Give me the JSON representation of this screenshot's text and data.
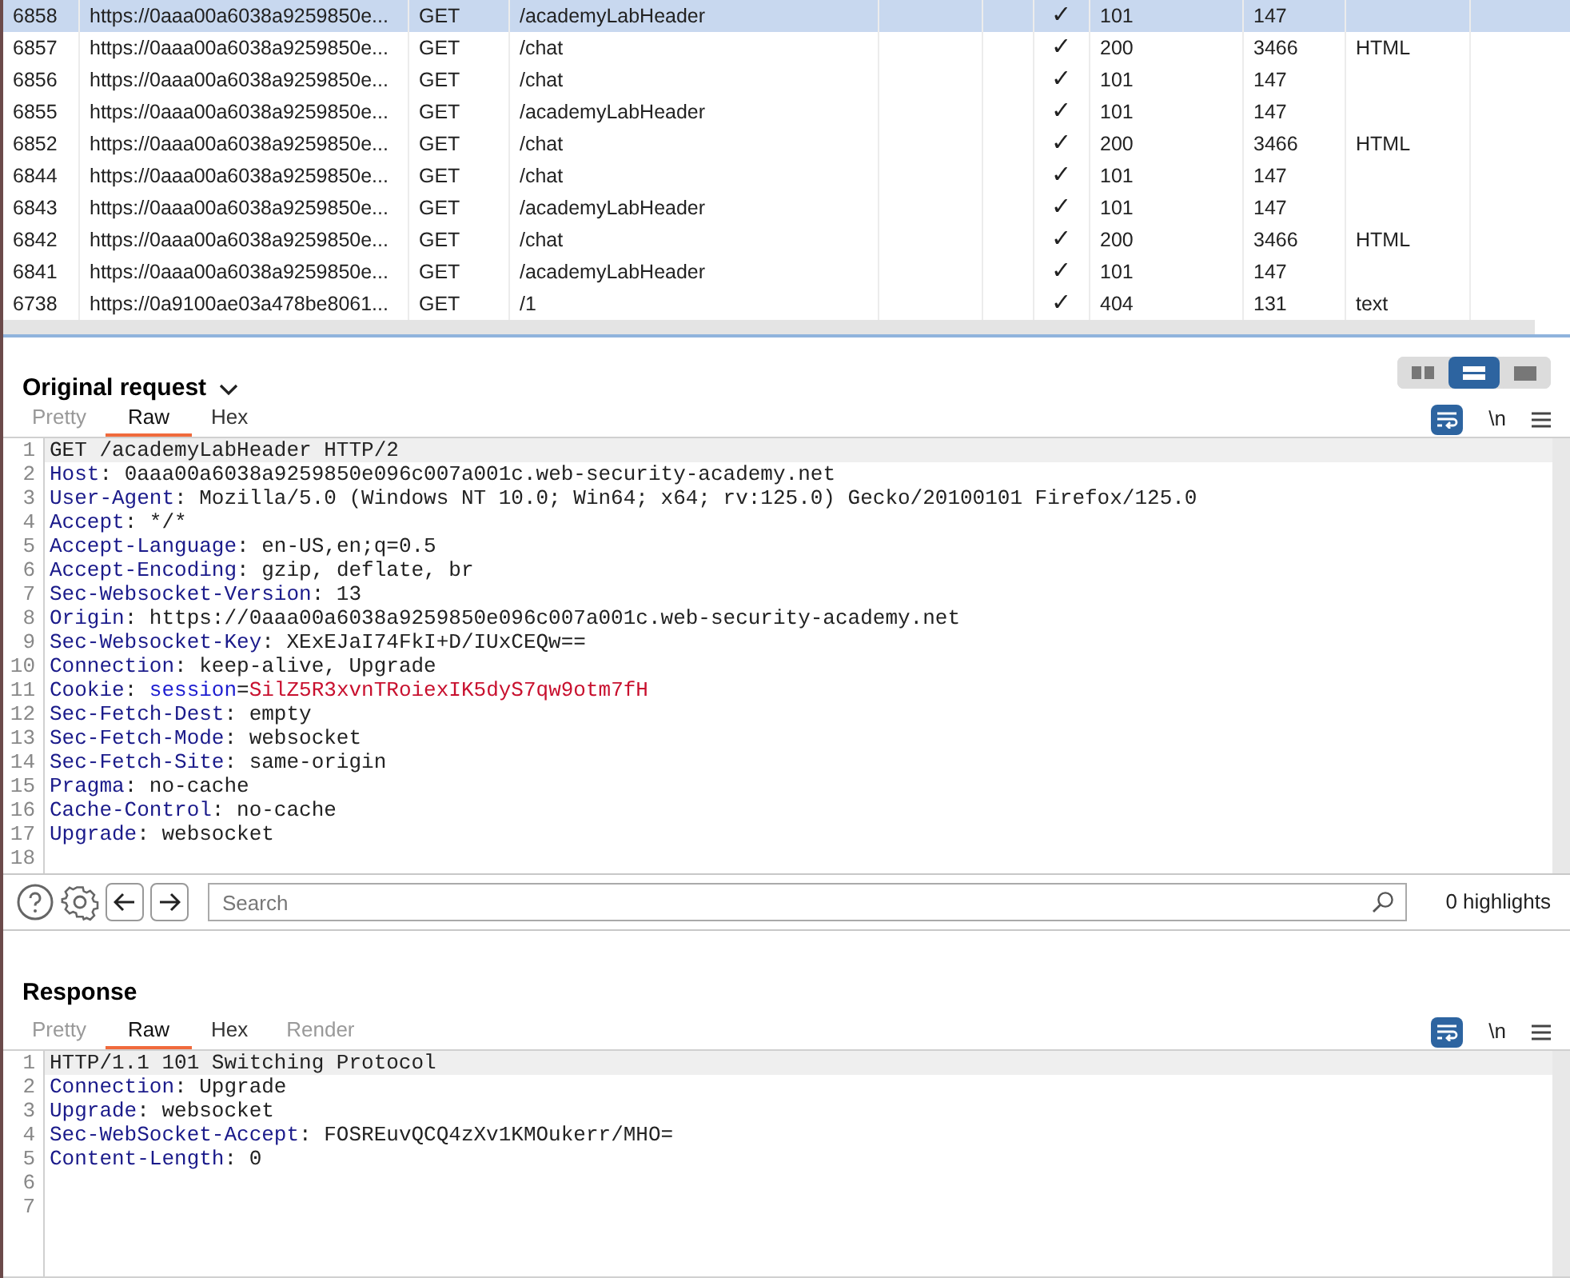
{
  "table": {
    "rows": [
      {
        "cells": [
          "6858",
          "https://0aaa00a6038a9259850e...",
          "GET",
          "/academyLabHeader",
          "✓",
          "101",
          "147",
          ""
        ],
        "selected": true
      },
      {
        "cells": [
          "6857",
          "https://0aaa00a6038a9259850e...",
          "GET",
          "/chat",
          "✓",
          "200",
          "3466",
          "HTML"
        ],
        "selected": false
      },
      {
        "cells": [
          "6856",
          "https://0aaa00a6038a9259850e...",
          "GET",
          "/chat",
          "✓",
          "101",
          "147",
          ""
        ],
        "selected": false
      },
      {
        "cells": [
          "6855",
          "https://0aaa00a6038a9259850e...",
          "GET",
          "/academyLabHeader",
          "✓",
          "101",
          "147",
          ""
        ],
        "selected": false
      },
      {
        "cells": [
          "6852",
          "https://0aaa00a6038a9259850e...",
          "GET",
          "/chat",
          "✓",
          "200",
          "3466",
          "HTML"
        ],
        "selected": false
      },
      {
        "cells": [
          "6844",
          "https://0aaa00a6038a9259850e...",
          "GET",
          "/chat",
          "✓",
          "101",
          "147",
          ""
        ],
        "selected": false
      },
      {
        "cells": [
          "6843",
          "https://0aaa00a6038a9259850e...",
          "GET",
          "/academyLabHeader",
          "✓",
          "101",
          "147",
          ""
        ],
        "selected": false
      },
      {
        "cells": [
          "6842",
          "https://0aaa00a6038a9259850e...",
          "GET",
          "/chat",
          "✓",
          "200",
          "3466",
          "HTML"
        ],
        "selected": false
      },
      {
        "cells": [
          "6841",
          "https://0aaa00a6038a9259850e...",
          "GET",
          "/academyLabHeader",
          "✓",
          "101",
          "147",
          ""
        ],
        "selected": false
      },
      {
        "cells": [
          "6738",
          "https://0a9100ae03a478be8061...",
          "GET",
          "/1",
          "✓",
          "404",
          "131",
          "text"
        ],
        "selected": false
      }
    ]
  },
  "request": {
    "title": "Original request",
    "layouts": [
      {
        "selected": false
      },
      {
        "selected": true
      },
      {
        "selected": false
      }
    ],
    "tabs": [
      {
        "label": "Pretty",
        "selected": false
      },
      {
        "label": "Raw",
        "selected": true
      },
      {
        "label": "Hex",
        "selected": false
      }
    ],
    "wrap_on": true,
    "newline_toggle": "\\n",
    "lines": [
      {
        "number": "1",
        "segments": [
          {
            "kind": "plain",
            "text": "GET /academyLabHeader HTTP/2"
          }
        ]
      },
      {
        "number": "2",
        "segments": [
          {
            "kind": "name",
            "text": "Host"
          },
          {
            "kind": "plain",
            "text": ": 0aaa00a6038a9259850e096c007a001c.web-security-academy.net"
          }
        ]
      },
      {
        "number": "3",
        "segments": [
          {
            "kind": "name",
            "text": "User-Agent"
          },
          {
            "kind": "plain",
            "text": ": Mozilla/5.0 (Windows NT 10.0; Win64; x64; rv:125.0) Gecko/20100101 Firefox/125.0"
          }
        ]
      },
      {
        "number": "4",
        "segments": [
          {
            "kind": "name",
            "text": "Accept"
          },
          {
            "kind": "plain",
            "text": ": */*"
          }
        ]
      },
      {
        "number": "5",
        "segments": [
          {
            "kind": "name",
            "text": "Accept-Language"
          },
          {
            "kind": "plain",
            "text": ": en-US,en;q=0.5"
          }
        ]
      },
      {
        "number": "6",
        "segments": [
          {
            "kind": "name",
            "text": "Accept-Encoding"
          },
          {
            "kind": "plain",
            "text": ": gzip, deflate, br"
          }
        ]
      },
      {
        "number": "7",
        "segments": [
          {
            "kind": "name",
            "text": "Sec-Websocket-Version"
          },
          {
            "kind": "plain",
            "text": ": 13"
          }
        ]
      },
      {
        "number": "8",
        "segments": [
          {
            "kind": "name",
            "text": "Origin"
          },
          {
            "kind": "plain",
            "text": ": https://0aaa00a6038a9259850e096c007a001c.web-security-academy.net"
          }
        ]
      },
      {
        "number": "9",
        "segments": [
          {
            "kind": "name",
            "text": "Sec-Websocket-Key"
          },
          {
            "kind": "plain",
            "text": ": XExEJaI74FkI+D/IUxCEQw=="
          }
        ]
      },
      {
        "number": "10",
        "segments": [
          {
            "kind": "name",
            "text": "Connection"
          },
          {
            "kind": "plain",
            "text": ": keep-alive, Upgrade"
          }
        ]
      },
      {
        "number": "11",
        "segments": [
          {
            "kind": "name",
            "text": "Cookie"
          },
          {
            "kind": "plain",
            "text": ": "
          },
          {
            "kind": "param",
            "text": "session"
          },
          {
            "kind": "plain",
            "text": "="
          },
          {
            "kind": "secret",
            "text": "SilZ5R3xvnTRoiexIK5dyS7qw9otm7fH"
          }
        ]
      },
      {
        "number": "12",
        "segments": [
          {
            "kind": "name",
            "text": "Sec-Fetch-Dest"
          },
          {
            "kind": "plain",
            "text": ": empty"
          }
        ]
      },
      {
        "number": "13",
        "segments": [
          {
            "kind": "name",
            "text": "Sec-Fetch-Mode"
          },
          {
            "kind": "plain",
            "text": ": websocket"
          }
        ]
      },
      {
        "number": "14",
        "segments": [
          {
            "kind": "name",
            "text": "Sec-Fetch-Site"
          },
          {
            "kind": "plain",
            "text": ": same-origin"
          }
        ]
      },
      {
        "number": "15",
        "segments": [
          {
            "kind": "name",
            "text": "Pragma"
          },
          {
            "kind": "plain",
            "text": ": no-cache"
          }
        ]
      },
      {
        "number": "16",
        "segments": [
          {
            "kind": "name",
            "text": "Cache-Control"
          },
          {
            "kind": "plain",
            "text": ": no-cache"
          }
        ]
      },
      {
        "number": "17",
        "segments": [
          {
            "kind": "name",
            "text": "Upgrade"
          },
          {
            "kind": "plain",
            "text": ": websocket"
          }
        ]
      },
      {
        "number": "18"
      }
    ]
  },
  "search": {
    "placeholder": "Search",
    "highlights": "0 highlights"
  },
  "response": {
    "title": "Response",
    "tabs": [
      {
        "label": "Pretty",
        "selected": false
      },
      {
        "label": "Raw",
        "selected": true
      },
      {
        "label": "Hex",
        "selected": false
      },
      {
        "label": "Render",
        "selected": false
      }
    ],
    "wrap_on": true,
    "newline_toggle": "\\n",
    "lines": [
      {
        "number": "1",
        "segments": [
          {
            "kind": "plain",
            "text": "HTTP/1.1 101 Switching Protocol"
          }
        ]
      },
      {
        "number": "2",
        "segments": [
          {
            "kind": "name",
            "text": "Connection"
          },
          {
            "kind": "plain",
            "text": ": Upgrade"
          }
        ]
      },
      {
        "number": "3",
        "segments": [
          {
            "kind": "name",
            "text": "Upgrade"
          },
          {
            "kind": "plain",
            "text": ": websocket"
          }
        ]
      },
      {
        "number": "4",
        "segments": [
          {
            "kind": "name",
            "text": "Sec-WebSocket-Accept"
          },
          {
            "kind": "plain",
            "text": ": FOSREuvQCQ4zXv1KMOukerr/MHO="
          }
        ]
      },
      {
        "number": "5",
        "segments": [
          {
            "kind": "name",
            "text": "Content-Length"
          },
          {
            "kind": "plain",
            "text": ": 0"
          }
        ]
      },
      {
        "number": "6"
      },
      {
        "number": "7"
      }
    ]
  }
}
